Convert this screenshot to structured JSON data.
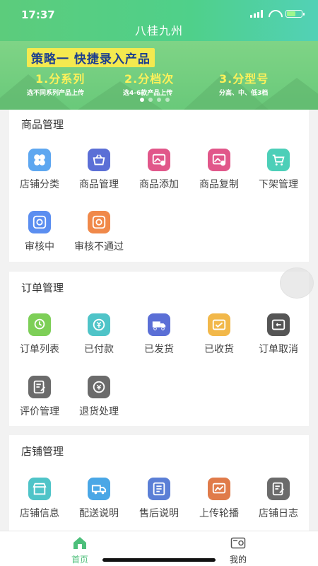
{
  "status_bar": {
    "time": "17:37"
  },
  "app_title": "八桂九州",
  "banner": {
    "title": "策略一 快捷录入产品",
    "steps": [
      {
        "heading": "1.分系列",
        "sub": "选不同系列产品上传"
      },
      {
        "heading": "2.分档次",
        "sub": "选4-6款产品上传"
      },
      {
        "heading": "3.分型号",
        "sub": "分高、中、低3档"
      }
    ],
    "carousel_pages": 4,
    "active_page": 1
  },
  "sections": [
    {
      "title": "商品管理",
      "items": [
        {
          "label": "店铺分类",
          "icon": "category-icon",
          "color": "#5ea7f0"
        },
        {
          "label": "商品管理",
          "icon": "basket-icon",
          "color": "#5b6fd6"
        },
        {
          "label": "商品添加",
          "icon": "image-add-icon",
          "color": "#e1578a"
        },
        {
          "label": "商品复制",
          "icon": "image-copy-icon",
          "color": "#e1578a"
        },
        {
          "label": "下架管理",
          "icon": "cart-icon",
          "color": "#4ccfb8"
        },
        {
          "label": "审核中",
          "icon": "review-icon",
          "color": "#5b8ef0"
        },
        {
          "label": "审核不通过",
          "icon": "review-fail-icon",
          "color": "#f0894a"
        }
      ]
    },
    {
      "title": "订单管理",
      "items": [
        {
          "label": "订单列表",
          "icon": "order-list-icon",
          "color": "#7dcf57"
        },
        {
          "label": "已付款",
          "icon": "paid-icon",
          "color": "#4fc4c8"
        },
        {
          "label": "已发货",
          "icon": "truck-icon",
          "color": "#5b6fd6"
        },
        {
          "label": "已收货",
          "icon": "received-icon",
          "color": "#f2b84a"
        },
        {
          "label": "订单取消",
          "icon": "cancel-order-icon",
          "color": "#555555"
        },
        {
          "label": "评价管理",
          "icon": "review-edit-icon",
          "color": "#6b6b6b"
        },
        {
          "label": "退货处理",
          "icon": "return-icon",
          "color": "#6b6b6b"
        }
      ]
    },
    {
      "title": "店铺管理",
      "items": [
        {
          "label": "店铺信息",
          "icon": "shop-icon",
          "color": "#4fc4c8"
        },
        {
          "label": "配送说明",
          "icon": "delivery-icon",
          "color": "#4aa7e6"
        },
        {
          "label": "售后说明",
          "icon": "after-sale-icon",
          "color": "#5b7fd6"
        },
        {
          "label": "上传轮播",
          "icon": "upload-banner-icon",
          "color": "#e07b4a"
        },
        {
          "label": "店铺日志",
          "icon": "log-icon",
          "color": "#6b6b6b"
        }
      ]
    }
  ],
  "tabbar": {
    "items": [
      {
        "label": "首页",
        "active": true,
        "color": "#4cbf7a"
      },
      {
        "label": "我的",
        "active": false,
        "color": "#333333"
      }
    ]
  }
}
